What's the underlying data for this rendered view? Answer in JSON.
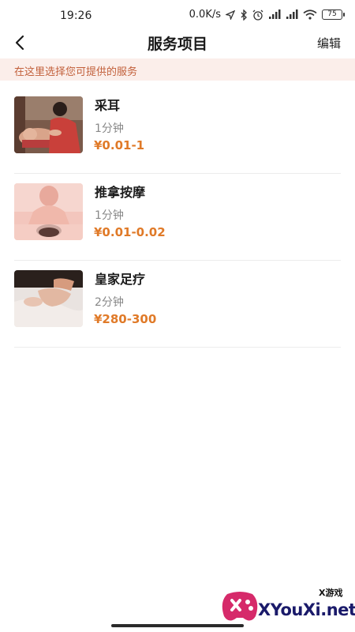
{
  "status_bar": {
    "time": "19:26",
    "network_speed": "0.0K/s",
    "battery_level": "75",
    "icons": [
      "location-icon",
      "bluetooth-icon",
      "alarm-icon",
      "signal-icon",
      "signal-icon",
      "wifi-icon",
      "battery-icon"
    ]
  },
  "header": {
    "back_icon": "back-arrow-icon",
    "title": "服务项目",
    "edit_label": "编辑"
  },
  "notice": {
    "text": "在这里选择您可提供的服务"
  },
  "services": [
    {
      "name": "采耳",
      "duration": "1分钟",
      "price": "¥0.01-1",
      "image_icon": "ear-cleaning-photo"
    },
    {
      "name": "推拿按摩",
      "duration": "1分钟",
      "price": "¥0.01-0.02",
      "image_icon": "massage-photo"
    },
    {
      "name": "皇家足疗",
      "duration": "2分钟",
      "price": "¥280-300",
      "image_icon": "foot-massage-photo"
    }
  ],
  "watermark": {
    "small_text": "X游戏",
    "big_text": "XYouXi.net"
  },
  "colors": {
    "notice_bg": "#fbeeea",
    "notice_text": "#c2603b",
    "price": "#e07a28",
    "divider": "#ececec"
  }
}
